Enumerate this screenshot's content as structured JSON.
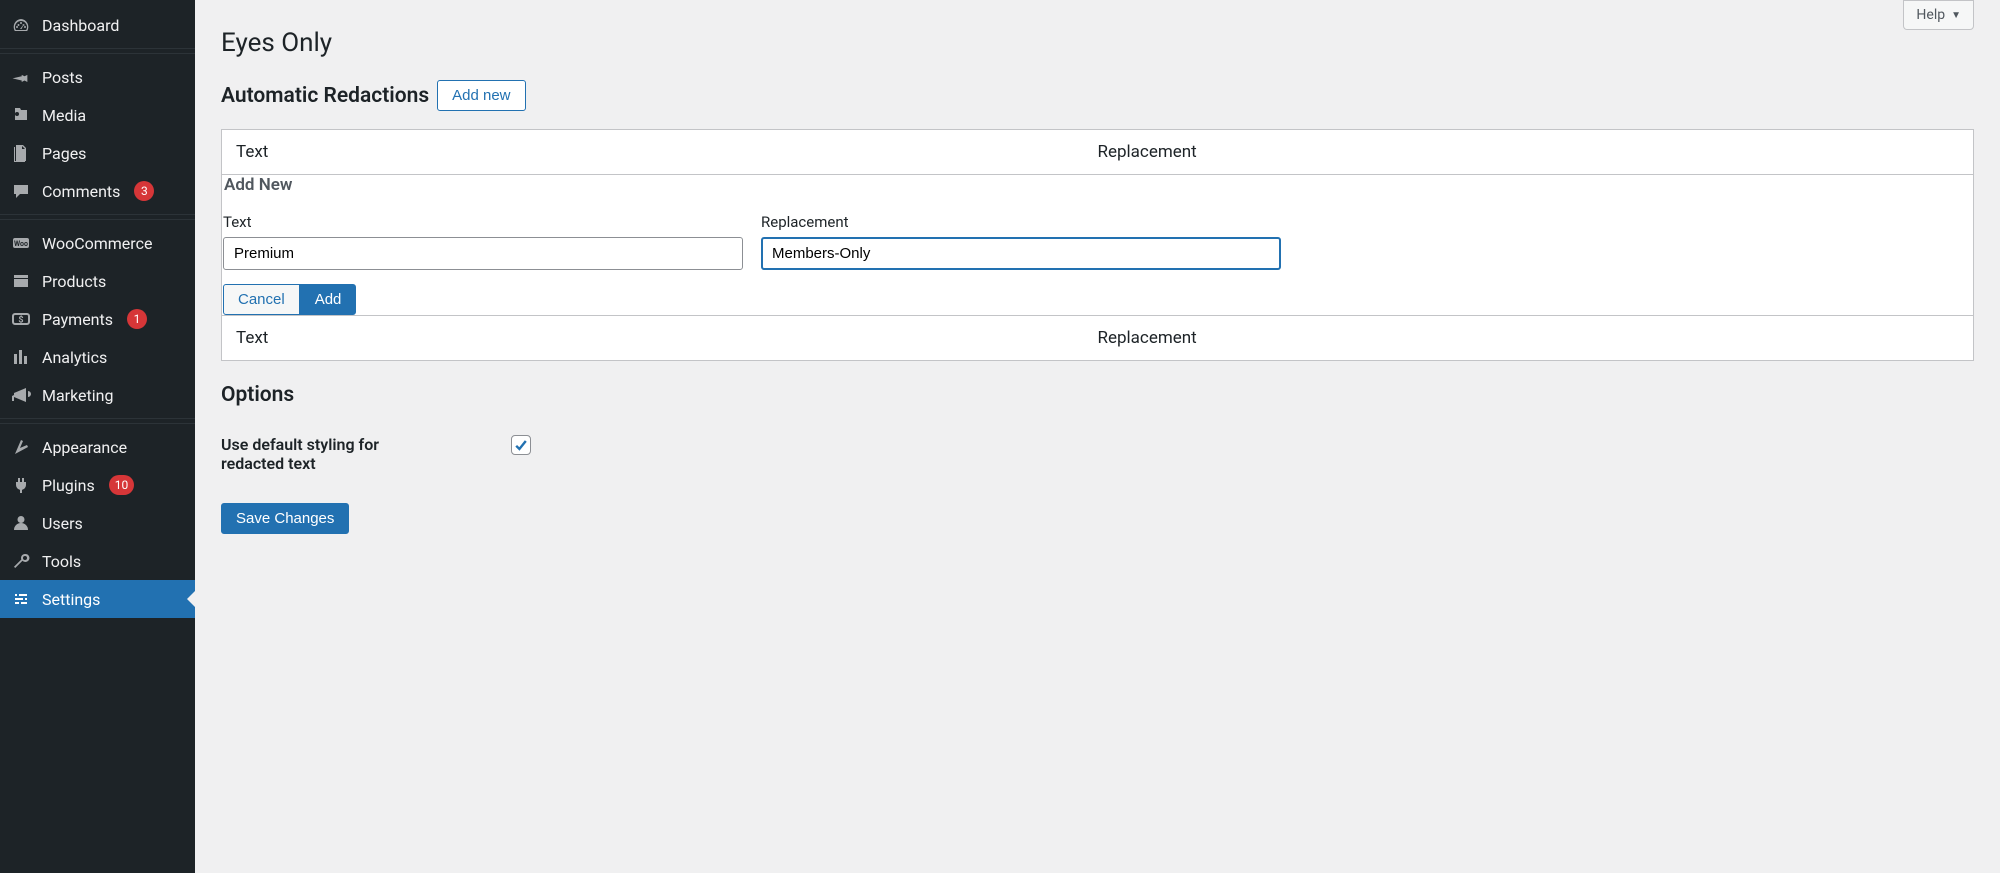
{
  "help_label": "Help",
  "page_title": "Eyes Only",
  "section1": {
    "title": "Automatic Redactions",
    "add_new_btn": "Add new"
  },
  "table": {
    "col_text": "Text",
    "col_replacement": "Replacement",
    "add_new_heading": "Add New",
    "form": {
      "text_label": "Text",
      "text_value": "Premium",
      "replacement_label": "Replacement",
      "replacement_value": "Members-Only",
      "cancel": "Cancel",
      "add": "Add"
    }
  },
  "options": {
    "title": "Options",
    "default_styling_label": "Use default styling for redacted text",
    "default_styling_checked": true
  },
  "save_button": "Save Changes",
  "sidebar": {
    "items": [
      {
        "id": "dashboard",
        "label": "Dashboard",
        "badge": null
      },
      {
        "id": "posts",
        "label": "Posts",
        "badge": null
      },
      {
        "id": "media",
        "label": "Media",
        "badge": null
      },
      {
        "id": "pages",
        "label": "Pages",
        "badge": null
      },
      {
        "id": "comments",
        "label": "Comments",
        "badge": "3"
      },
      {
        "id": "woocommerce",
        "label": "WooCommerce",
        "badge": null
      },
      {
        "id": "products",
        "label": "Products",
        "badge": null
      },
      {
        "id": "payments",
        "label": "Payments",
        "badge": "1"
      },
      {
        "id": "analytics",
        "label": "Analytics",
        "badge": null
      },
      {
        "id": "marketing",
        "label": "Marketing",
        "badge": null
      },
      {
        "id": "appearance",
        "label": "Appearance",
        "badge": null
      },
      {
        "id": "plugins",
        "label": "Plugins",
        "badge": "10"
      },
      {
        "id": "users",
        "label": "Users",
        "badge": null
      },
      {
        "id": "tools",
        "label": "Tools",
        "badge": null
      },
      {
        "id": "settings",
        "label": "Settings",
        "badge": null
      }
    ]
  }
}
